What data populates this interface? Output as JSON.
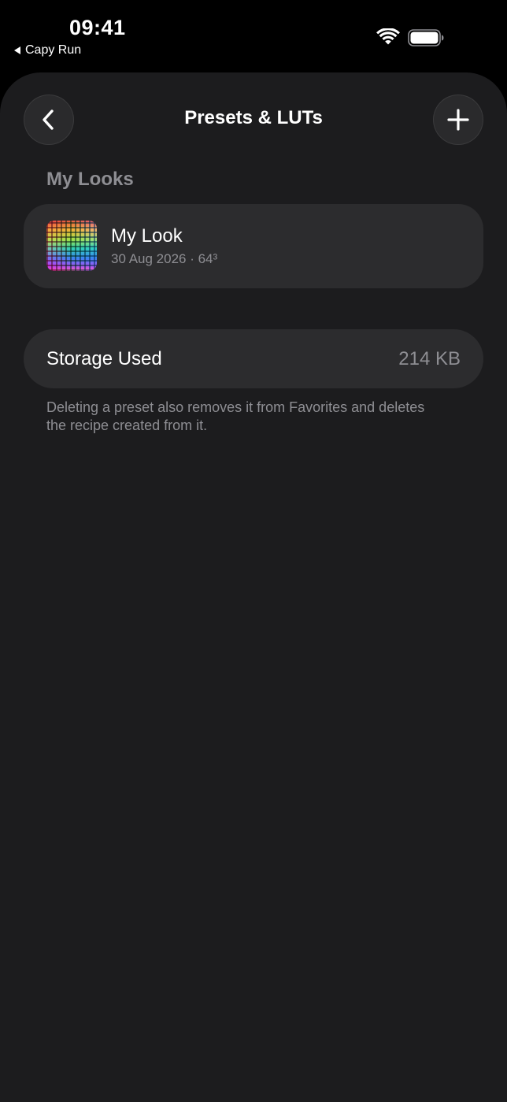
{
  "status_bar": {
    "time": "09:41",
    "back_app": "Capy Run",
    "icons": [
      "wifi-icon",
      "battery-icon"
    ]
  },
  "nav": {
    "title": "Presets & LUTs",
    "back_icon": "chevron-left-icon",
    "add_icon": "plus-icon"
  },
  "my_looks": {
    "header": "My Looks",
    "items": [
      {
        "name": "My Look",
        "date": "30 Aug 2026",
        "size": "· 64³"
      }
    ]
  },
  "storage": {
    "label": "Storage Used",
    "value": "214 KB"
  },
  "footnote": "Deleting a preset also removes it from Favorites and deletes the recipe created from it.",
  "colors": {
    "background": "#000000",
    "sheet": "#1c1c1e",
    "card": "#2c2c2e",
    "secondary_text": "#8e8e93",
    "primary_text": "#ffffff"
  }
}
